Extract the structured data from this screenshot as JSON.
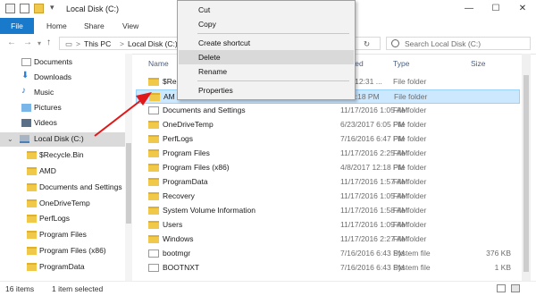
{
  "window": {
    "title": "Local Disk (C:)",
    "controls": [
      "—",
      "☐",
      "✕"
    ]
  },
  "ribbon": {
    "tabs": [
      "File",
      "Home",
      "Share",
      "View"
    ]
  },
  "address": {
    "crumbs": [
      "This PC",
      "Local Disk (C:)"
    ],
    "separator": ">",
    "search_placeholder": "Search Local Disk (C:)"
  },
  "nav": {
    "items": [
      {
        "label": "Documents"
      },
      {
        "label": "Downloads"
      },
      {
        "label": "Music"
      },
      {
        "label": "Pictures"
      },
      {
        "label": "Videos"
      },
      {
        "label": "Local Disk (C:)"
      },
      {
        "label": "$Recycle.Bin"
      },
      {
        "label": "AMD"
      },
      {
        "label": "Documents and Settings"
      },
      {
        "label": "OneDriveTemp"
      },
      {
        "label": "PerfLogs"
      },
      {
        "label": "Program Files"
      },
      {
        "label": "Program Files (x86)"
      },
      {
        "label": "ProgramData"
      }
    ]
  },
  "columns": {
    "name": "Name",
    "date": "fied",
    "type": "Type",
    "size": "Size"
  },
  "files": [
    {
      "name": "$Re",
      "date": "8 12:31 ...",
      "type": "File folder",
      "size": ""
    },
    {
      "name": "AM",
      "date": "3:18 PM",
      "type": "File folder",
      "size": ""
    },
    {
      "name": "Documents and Settings",
      "date": "11/17/2016 1:05 AM",
      "type": "File folder",
      "size": ""
    },
    {
      "name": "OneDriveTemp",
      "date": "6/23/2017 6:05 PM",
      "type": "File folder",
      "size": ""
    },
    {
      "name": "PerfLogs",
      "date": "7/16/2016 6:47 PM",
      "type": "File folder",
      "size": ""
    },
    {
      "name": "Program Files",
      "date": "11/17/2016 2:25 AM",
      "type": "File folder",
      "size": ""
    },
    {
      "name": "Program Files (x86)",
      "date": "4/8/2017 12:18 PM",
      "type": "File folder",
      "size": ""
    },
    {
      "name": "ProgramData",
      "date": "11/17/2016 1:57 AM",
      "type": "File folder",
      "size": ""
    },
    {
      "name": "Recovery",
      "date": "11/17/2016 1:05 AM",
      "type": "File folder",
      "size": ""
    },
    {
      "name": "System Volume Information",
      "date": "11/17/2016 1:58 AM",
      "type": "File folder",
      "size": ""
    },
    {
      "name": "Users",
      "date": "11/17/2016 1:09 AM",
      "type": "File folder",
      "size": ""
    },
    {
      "name": "Windows",
      "date": "11/17/2016 2:27 AM",
      "type": "File folder",
      "size": ""
    },
    {
      "name": "bootmgr",
      "date": "7/16/2016 6:43 PM",
      "type": "System file",
      "size": "376 KB"
    },
    {
      "name": "BOOTNXT",
      "date": "7/16/2016 6:43 PM",
      "type": "System file",
      "size": "1 KB"
    },
    {
      "name": "",
      "date": "",
      "type": "",
      "size": ""
    }
  ],
  "context_menu": {
    "items": [
      "Cut",
      "Copy",
      "Create shortcut",
      "Delete",
      "Rename",
      "Properties"
    ]
  },
  "status": {
    "count": "16 items",
    "selected": "1 item selected"
  },
  "colors": {
    "accent": "#1979ca",
    "selection": "#cce8ff",
    "highlight": "#dadada",
    "folder": "#f0c94a",
    "arrow": "#e0181a"
  }
}
